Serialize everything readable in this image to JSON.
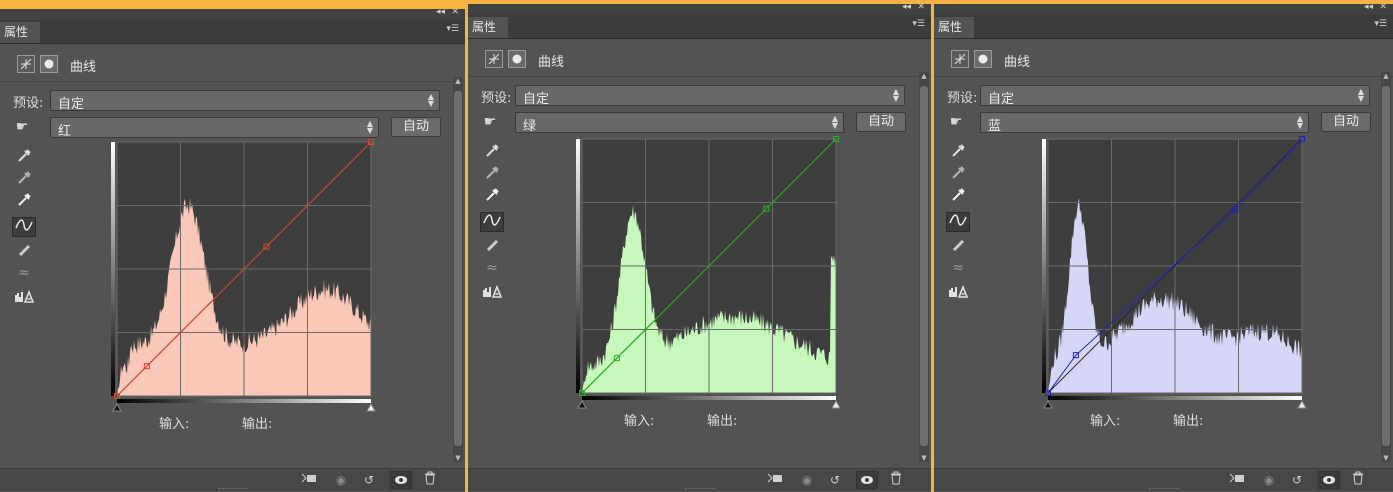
{
  "panels": [
    {
      "tab_label": "属性",
      "header_title": "曲线",
      "preset_label": "预设:",
      "preset_value": "自定",
      "channel_value": "红",
      "auto_label": "自动",
      "input_label": "输入:",
      "output_label": "输出:",
      "curve_color": "#e0442c",
      "hist_color": "#f9c8b8",
      "points": [
        [
          0,
          0
        ],
        [
          30,
          30
        ],
        [
          150,
          150
        ],
        [
          255,
          255
        ]
      ]
    },
    {
      "tab_label": "属性",
      "header_title": "曲线",
      "preset_label": "预设:",
      "preset_value": "自定",
      "channel_value": "绿",
      "auto_label": "自动",
      "input_label": "输入:",
      "output_label": "输出:",
      "curve_color": "#22b51c",
      "hist_color": "#c6f7bb",
      "points": [
        [
          0,
          0
        ],
        [
          35,
          35
        ],
        [
          185,
          185
        ],
        [
          255,
          255
        ]
      ]
    },
    {
      "tab_label": "属性",
      "header_title": "曲线",
      "preset_label": "预设:",
      "preset_value": "自定",
      "channel_value": "蓝",
      "auto_label": "自动",
      "input_label": "输入:",
      "output_label": "输出:",
      "curve_color": "#1e22cc",
      "hist_color": "#d6d6f6",
      "points": [
        [
          0,
          0
        ],
        [
          28,
          38
        ],
        [
          188,
          184
        ],
        [
          255,
          255
        ]
      ]
    }
  ],
  "icons": {
    "tab_menu": "panel-menu-icon",
    "collapse": "collapse-icon",
    "close": "close-icon",
    "adjustment": "curves-adjustment-icon",
    "mask": "mask-icon",
    "target": "on-image-adjust-icon",
    "black_point": "black-point-eyedropper-icon",
    "gray_point": "gray-point-eyedropper-icon",
    "white_point": "white-point-eyedropper-icon",
    "curve_tool": "edit-points-curve-icon",
    "pencil": "pencil-draw-icon",
    "smooth": "smooth-curve-icon",
    "clipping": "clipping-warning-icon",
    "clip_layer": "clip-to-layer-icon",
    "view_previous": "view-previous-state-icon",
    "reset": "reset-icon",
    "visibility": "visibility-eye-icon",
    "delete": "trash-icon"
  }
}
